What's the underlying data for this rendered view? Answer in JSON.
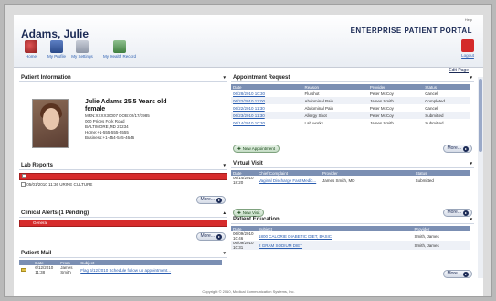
{
  "header": {
    "patient_name": "Adams, Julie",
    "portal_title": "ENTERPRISE PATIENT PORTAL",
    "help_label": "Help",
    "nav": [
      {
        "label": "Home",
        "icon": "home-icon"
      },
      {
        "label": "My Profile",
        "icon": "profile-icon"
      },
      {
        "label": "My Settings",
        "icon": "settings-icon"
      },
      {
        "label": "My Health Record",
        "icon": "health-record-icon"
      }
    ],
    "logout_label": "Logout",
    "edit_page": "Edit Page"
  },
  "patient_info": {
    "title": "Patient Information",
    "name_line": "Julie Adams 25.5 Years old",
    "sex": "female",
    "ids": "MRN:XXXX30007 DOB:02/17/1985",
    "address1": "000 Prices Fork Road",
    "address2": "BALTIMORE,MD 21234",
    "home": "Home:+1-555-555-5555",
    "business": "Business:+1-454-545-4646"
  },
  "lab_reports": {
    "title": "Lab Reports",
    "row_date": "05/01/2010 11:36",
    "row_desc": "URINE CULTURE",
    "more": "More..."
  },
  "clinical_alerts": {
    "title": "Clinical Alerts (1 Pending)",
    "alert": "General",
    "more": "More..."
  },
  "patient_mail": {
    "title": "Patient Mail",
    "columns": [
      "",
      "Date",
      "From",
      "Subject"
    ],
    "row": {
      "date": "6/12/2010 11:38",
      "from": "James Smith",
      "subject": "Flag 6/12/2010 Schedule follow up appointment..."
    }
  },
  "appointment": {
    "title": "Appointment Request",
    "columns": [
      "Date",
      "Reason",
      "Provider",
      "Status"
    ],
    "rows": [
      {
        "date": "06/28/2010 10:30",
        "reason": "Flu shot",
        "provider": "Peter McCoy",
        "status": "Cancel"
      },
      {
        "date": "06/22/2010 12:00",
        "reason": "Abdominal Pain",
        "provider": "James Smith",
        "status": "Completed"
      },
      {
        "date": "06/22/2010 11:30",
        "reason": "Abdominal Pain",
        "provider": "Peter McCoy",
        "status": "Cancel"
      },
      {
        "date": "06/23/2010 11:30",
        "reason": "Allergy Shot",
        "provider": "Peter McCoy",
        "status": "Submitted"
      },
      {
        "date": "06/14/2010 10:30",
        "reason": "Lab works",
        "provider": "James Smith",
        "status": "Submitted"
      }
    ],
    "new_btn": "New Appointment",
    "more": "More..."
  },
  "virtual_visit": {
    "title": "Virtual Visit",
    "columns": [
      "Date",
      "Chief Complaint",
      "Provider",
      "Status"
    ],
    "row": {
      "date": "06/14/2010 18:20",
      "complaint": "Vaginal Discharge Fast Medic...",
      "provider": "James Smith, MD",
      "status": "Submitted"
    },
    "new_btn": "New Visit",
    "more": "More..."
  },
  "patient_education": {
    "title": "Patient Education",
    "columns": [
      "Date",
      "Subject",
      "Provider"
    ],
    "rows": [
      {
        "date": "06/09/2010 10:46",
        "subject": "1800 CALORIE DIABETIC DIET, BASIC",
        "provider": "Smith, James"
      },
      {
        "date": "06/09/2010 10:31",
        "subject": "2 GRAM SODIUM DIET",
        "provider": "Smith, James"
      }
    ],
    "more": "More..."
  },
  "footer": "Copyright © 2010, Medical Communication Systems, Inc."
}
